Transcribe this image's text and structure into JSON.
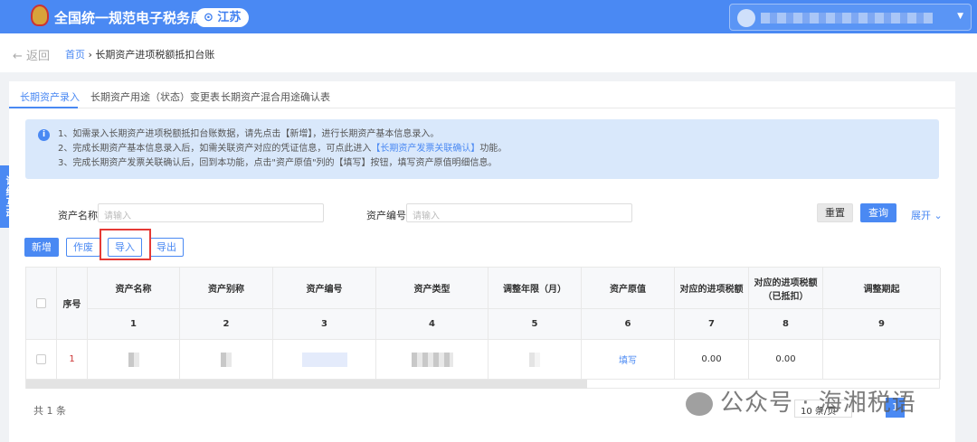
{
  "header": {
    "title": "全国统一规范电子税务局",
    "province": "江苏",
    "user_name": "(redacted)"
  },
  "breadcrumb": {
    "back": "返回",
    "home": "首页",
    "current": "长期资产进项税额抵扣台账"
  },
  "tabs": [
    {
      "label": "长期资产录入",
      "active": true
    },
    {
      "label": "长期资产用途（状态）变更表"
    },
    {
      "label": "长期资产混合用途确认表"
    }
  ],
  "info": {
    "line1": "1、如需录入长期资产进项税额抵扣台账数据，请先点击【新增】，进行长期资产基本信息录入。",
    "line2_pre": "2、完成长期资产基本信息录入后，如需关联资产对应的凭证信息，可点此进入",
    "line2_link": "【长期资产发票关联确认】",
    "line2_post": "功能。",
    "line3": "3、完成长期资产发票关联确认后，回到本功能，点击\"资产原值\"列的【填写】按钮，填写资产原值明细信息。"
  },
  "side_tab": "证纳互动",
  "search": {
    "name_label": "资产名称",
    "name_placeholder": "请输入",
    "code_label": "资产编号",
    "code_placeholder": "请输入",
    "reset": "重置",
    "query": "查询",
    "expand": "展开 ⌄"
  },
  "actions": {
    "add": "新增",
    "void": "作废",
    "import": "导入",
    "export": "导出"
  },
  "table": {
    "headers": [
      "序号",
      "资产名称",
      "资产别称",
      "资产编号",
      "资产类型",
      "调整年限（月）",
      "资产原值",
      "对应的进项税额",
      "对应的进项税额（已抵扣）",
      "调整期起"
    ],
    "col_numbers": [
      "1",
      "2",
      "3",
      "4",
      "5",
      "6",
      "7",
      "8",
      "9"
    ],
    "rows": [
      {
        "index": "1",
        "original_value": "填写",
        "tax": "0.00",
        "tax_deducted": "0.00"
      }
    ]
  },
  "pagination": {
    "total": "共 1 条",
    "page_size": "10 条/页",
    "current_page": "1"
  },
  "watermark": "公众号 · 海湘税语",
  "colors": {
    "primary": "#4a89f3",
    "highlight": "#e53935"
  }
}
